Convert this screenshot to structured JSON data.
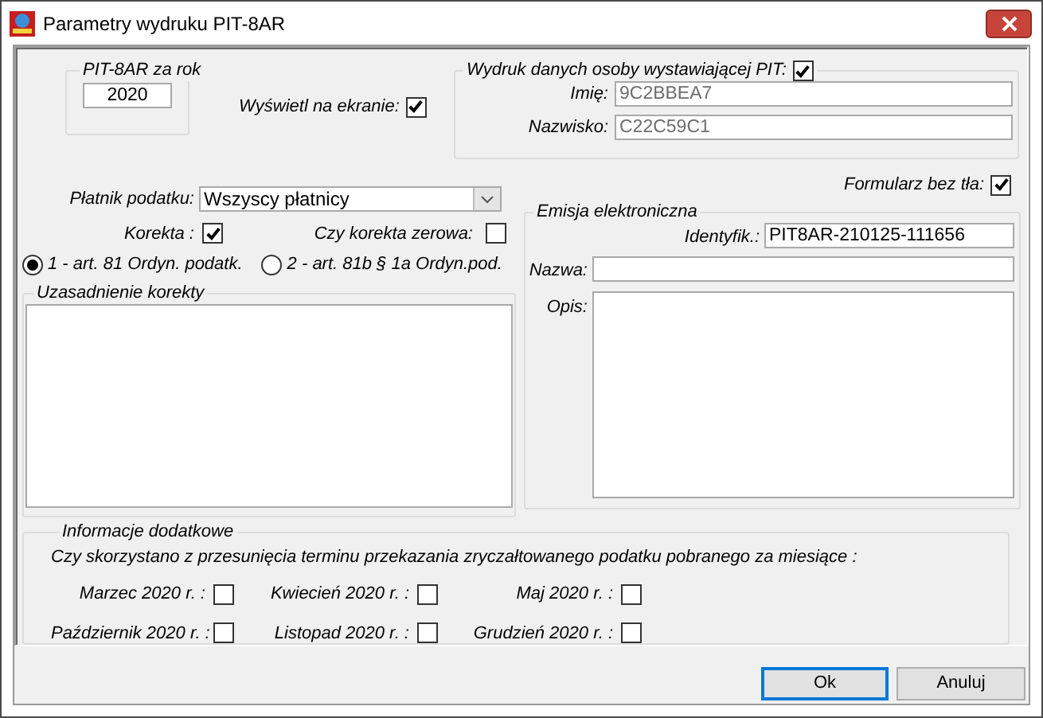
{
  "window": {
    "title": "Parametry wydruku PIT-8AR"
  },
  "year_group": {
    "legend": "PIT-8AR za rok",
    "value": "2020"
  },
  "show_on_screen": {
    "label": "Wyświetl na ekranie:",
    "checked": true
  },
  "issuer_group": {
    "legend": "Wydruk danych osoby wystawiającej PIT:",
    "checked": true,
    "fields": [
      {
        "label": "Imię:",
        "value": "9C2BBEA7",
        "disabled": true
      },
      {
        "label": "Nazwisko:",
        "value": "C22C59C1",
        "disabled": true
      }
    ]
  },
  "payer": {
    "label": "Płatnik podatku:",
    "value": "Wszyscy płatnicy"
  },
  "correction": {
    "label": "Korekta :",
    "checked": true
  },
  "zero_correction": {
    "label": "Czy korekta zerowa:",
    "checked": false
  },
  "correction_basis": [
    {
      "label": "1 - art. 81 Ordyn. podatk.",
      "selected": true
    },
    {
      "label": "2 - art. 81b § 1a Ordyn.pod.",
      "selected": false
    }
  ],
  "justification": {
    "legend": "Uzasadnienie korekty"
  },
  "no_background": {
    "label": "Formularz bez tła:",
    "checked": true
  },
  "e_emission": {
    "legend": "Emisja elektroniczna",
    "fields": [
      {
        "label": "Identyfik.:",
        "value": "PIT8AR-210125-111656",
        "kind": "short"
      },
      {
        "label": "Nazwa:",
        "kind": "line"
      },
      {
        "label": "Opis:",
        "kind": "multiline"
      }
    ]
  },
  "additional_info": {
    "legend": "Informacje dodatkowe",
    "question": "Czy skorzystano z przesunięcia terminu przekazania zryczałtowanego podatku pobranego za miesiące :",
    "months": [
      {
        "label": "Marzec 2020 r. :",
        "checked": false
      },
      {
        "label": "Kwiecień 2020 r. :",
        "checked": false
      },
      {
        "label": "Maj 2020 r. :",
        "checked": false
      },
      {
        "label": "Październik 2020 r. :",
        "checked": false
      },
      {
        "label": "Listopad 2020 r. :",
        "checked": false
      },
      {
        "label": "Grudzień 2020 r. :",
        "checked": false
      }
    ]
  },
  "buttons": [
    {
      "label": "Ok",
      "default": true
    },
    {
      "label": "Anuluj",
      "default": false
    }
  ]
}
